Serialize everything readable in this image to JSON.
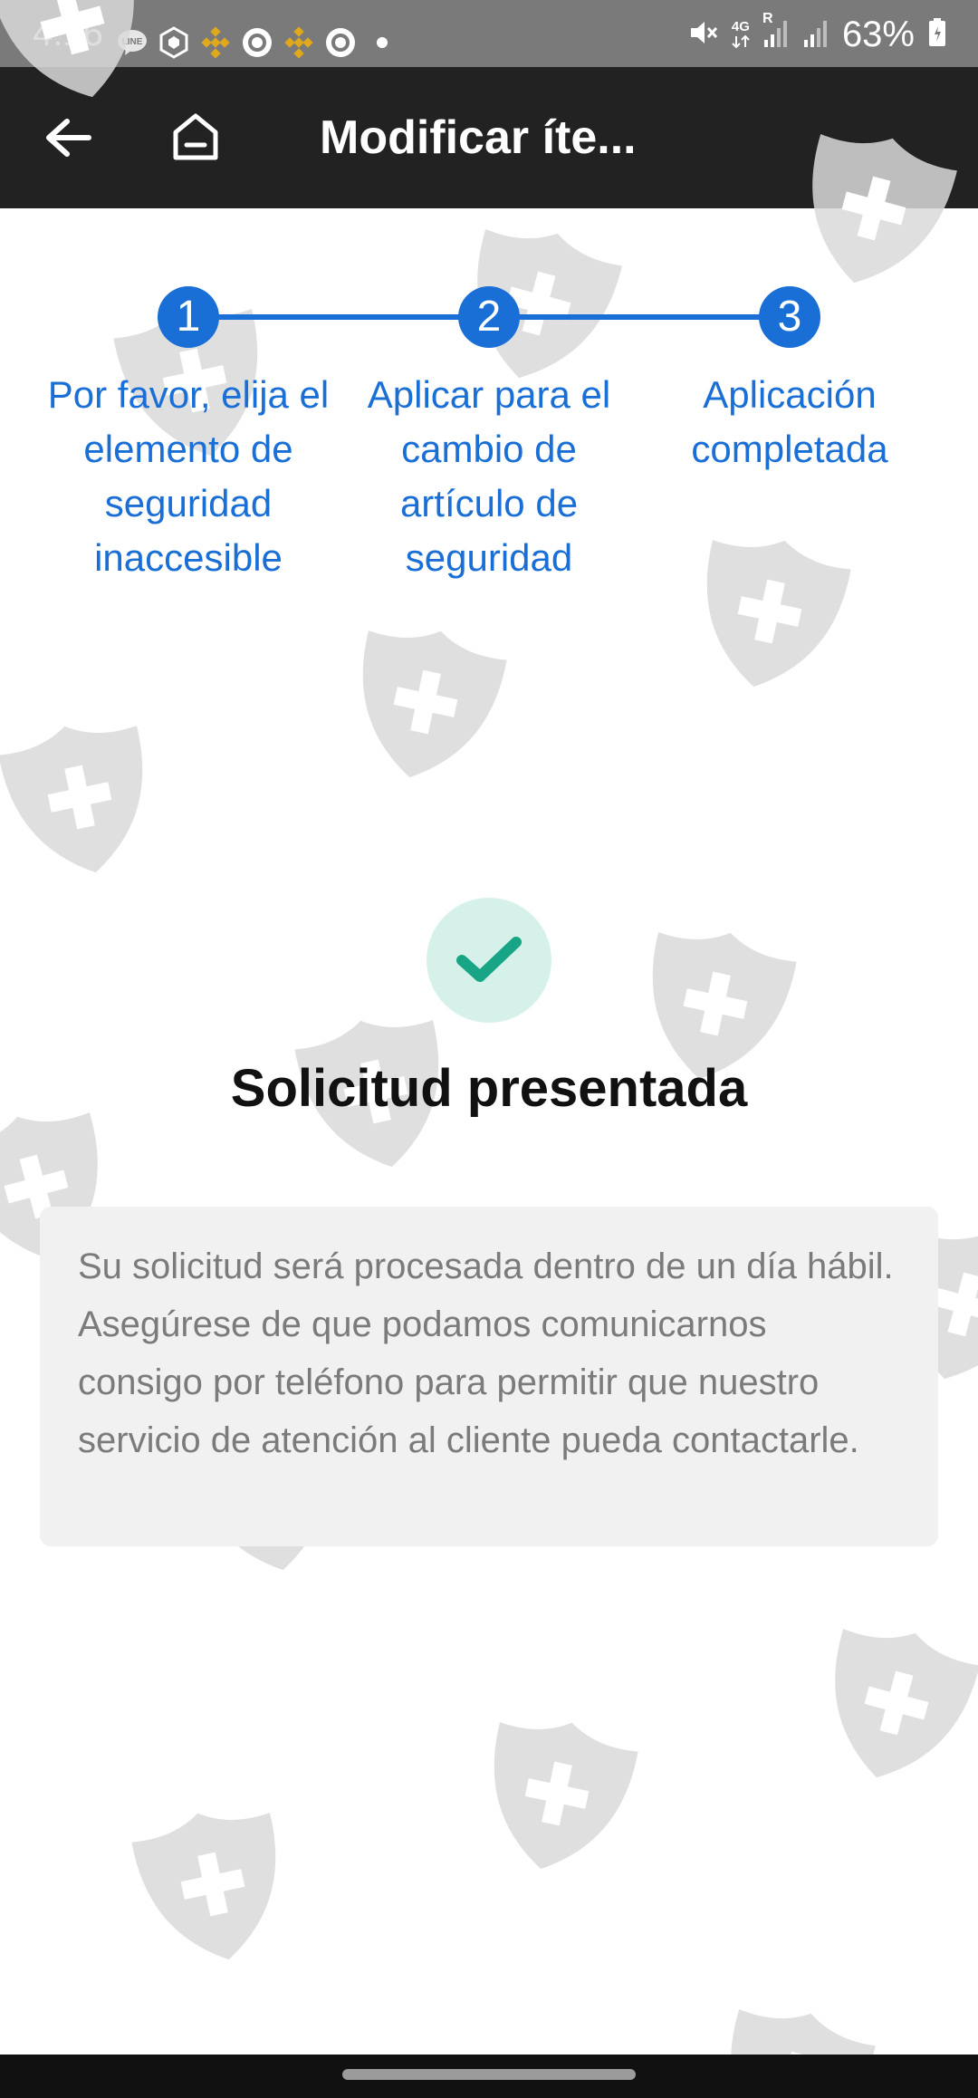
{
  "status_bar": {
    "time": "4:16",
    "battery": "63%",
    "network": "4G",
    "roaming": "R",
    "left_icons": [
      "line-icon",
      "crypto-com-icon",
      "binance-icon",
      "circle-app-icon",
      "binance-icon",
      "circle-app-icon",
      "dot-icon"
    ],
    "right_icons": [
      "mute-icon",
      "signal-icon",
      "signal-icon",
      "battery-icon"
    ]
  },
  "toolbar": {
    "title": "Modificar íte...",
    "back_icon": "arrow-left-icon",
    "home_icon": "home-icon"
  },
  "stepper": {
    "steps": [
      {
        "number": "1",
        "label": "Por favor, elija el elemento de seguridad inaccesible"
      },
      {
        "number": "2",
        "label": "Aplicar para el cambio de artículo de seguridad"
      },
      {
        "number": "3",
        "label": "Aplicación completada"
      }
    ],
    "active_color": "#1a6fd6"
  },
  "result": {
    "icon": "check-icon",
    "title": "Solicitud presentada",
    "message": "Su solicitud será procesada dentro de un día hábil. Asegúrese de que podamos comunicarnos consigo por teléfono para permitir que nuestro servicio de atención al cliente pueda contactarle."
  },
  "colors": {
    "accent": "#1a6fd6",
    "success": "#17a585",
    "success_bg": "#d6f1ea",
    "toolbar_bg": "#222222"
  }
}
